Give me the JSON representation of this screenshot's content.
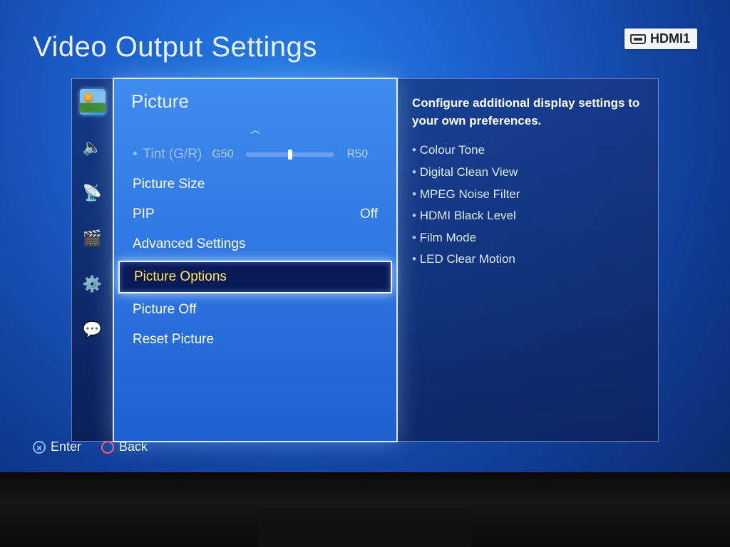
{
  "title": "Video Output Settings",
  "input_source": "HDMI1",
  "menu": {
    "header": "Picture",
    "items": [
      {
        "label": "Tint (G/R)",
        "left_value": "G50",
        "right_value": "R50",
        "type": "slider",
        "disabled": true
      },
      {
        "label": "Picture Size"
      },
      {
        "label": "PIP",
        "value": "Off"
      },
      {
        "label": "Advanced Settings"
      },
      {
        "label": "Picture Options",
        "selected": true
      },
      {
        "label": "Picture Off"
      },
      {
        "label": "Reset Picture"
      }
    ]
  },
  "help": {
    "title": "Configure additional display settings to your own preferences.",
    "bullets": [
      "Colour Tone",
      "Digital Clean View",
      "MPEG Noise Filter",
      "HDMI Black Level",
      "Film Mode",
      "LED Clear Motion"
    ]
  },
  "footer": {
    "enter": "Enter",
    "back": "Back"
  },
  "sidebar_icons": [
    "picture-icon",
    "sound-icon",
    "network-icon",
    "applications-icon",
    "system-icon",
    "support-icon"
  ]
}
